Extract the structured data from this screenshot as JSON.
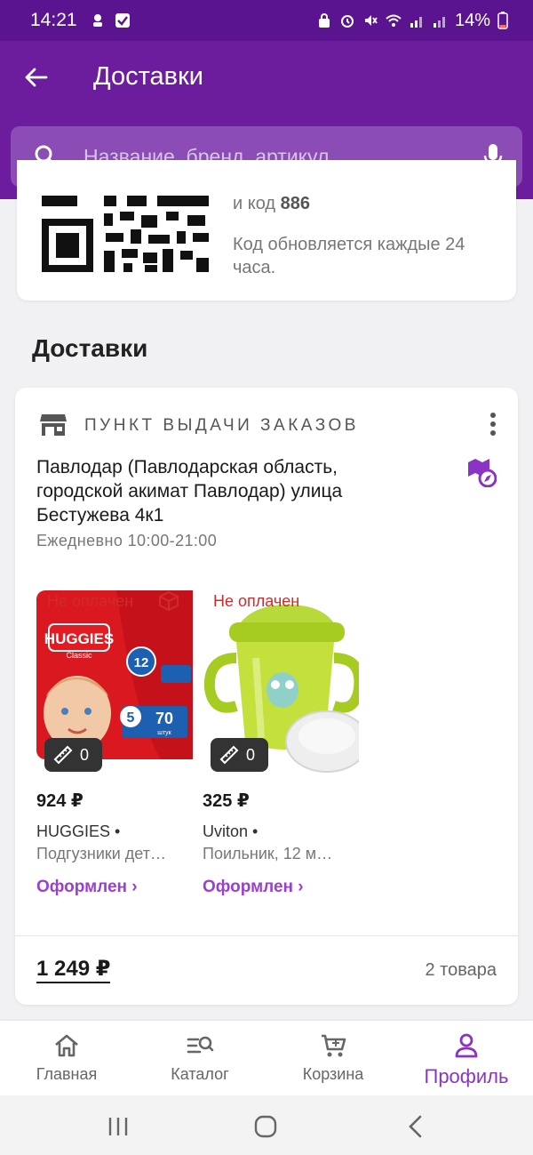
{
  "status_bar": {
    "time": "14:21",
    "battery": "14%"
  },
  "header": {
    "title": "Доставки"
  },
  "search": {
    "placeholder": "Название, бренд, артикул"
  },
  "qr_card": {
    "code_prefix": "и код",
    "code": "886",
    "note": "Код обновляется каждые 24 часа."
  },
  "section_title": "Доставки",
  "delivery": {
    "type": "ПУНКТ ВЫДАЧИ ЗАКАЗОВ",
    "address": "Павлодар (Павлодарская область, городской акимат Павлодар) улица Бестужева 4к1",
    "hours": "Ежедневно 10:00-21:00",
    "products": [
      {
        "status": "Не оплачен",
        "badge_count": "0",
        "price": "924 ₽",
        "brand": "HUGGIES •",
        "name": "Подгузники дет…",
        "state": "Оформлен ›",
        "image": "huggies-diapers-pack"
      },
      {
        "status": "Не оплачен",
        "badge_count": "0",
        "price": "325 ₽",
        "brand": "Uviton •",
        "name": "Поильник, 12 м…",
        "state": "Оформлен ›",
        "image": "green-sippy-cup"
      }
    ],
    "total": "1 249 ₽",
    "count": "2 товара"
  },
  "bottom_nav": [
    {
      "label": "Главная",
      "icon": "home-icon"
    },
    {
      "label": "Каталог",
      "icon": "catalog-search-icon"
    },
    {
      "label": "Корзина",
      "icon": "cart-icon"
    },
    {
      "label": "Профиль",
      "icon": "profile-icon",
      "active": true
    }
  ],
  "colors": {
    "header": "#6b1d9e",
    "status_bar": "#5b1490",
    "accent": "#8a34c4",
    "unpaid": "#d02b2b"
  }
}
